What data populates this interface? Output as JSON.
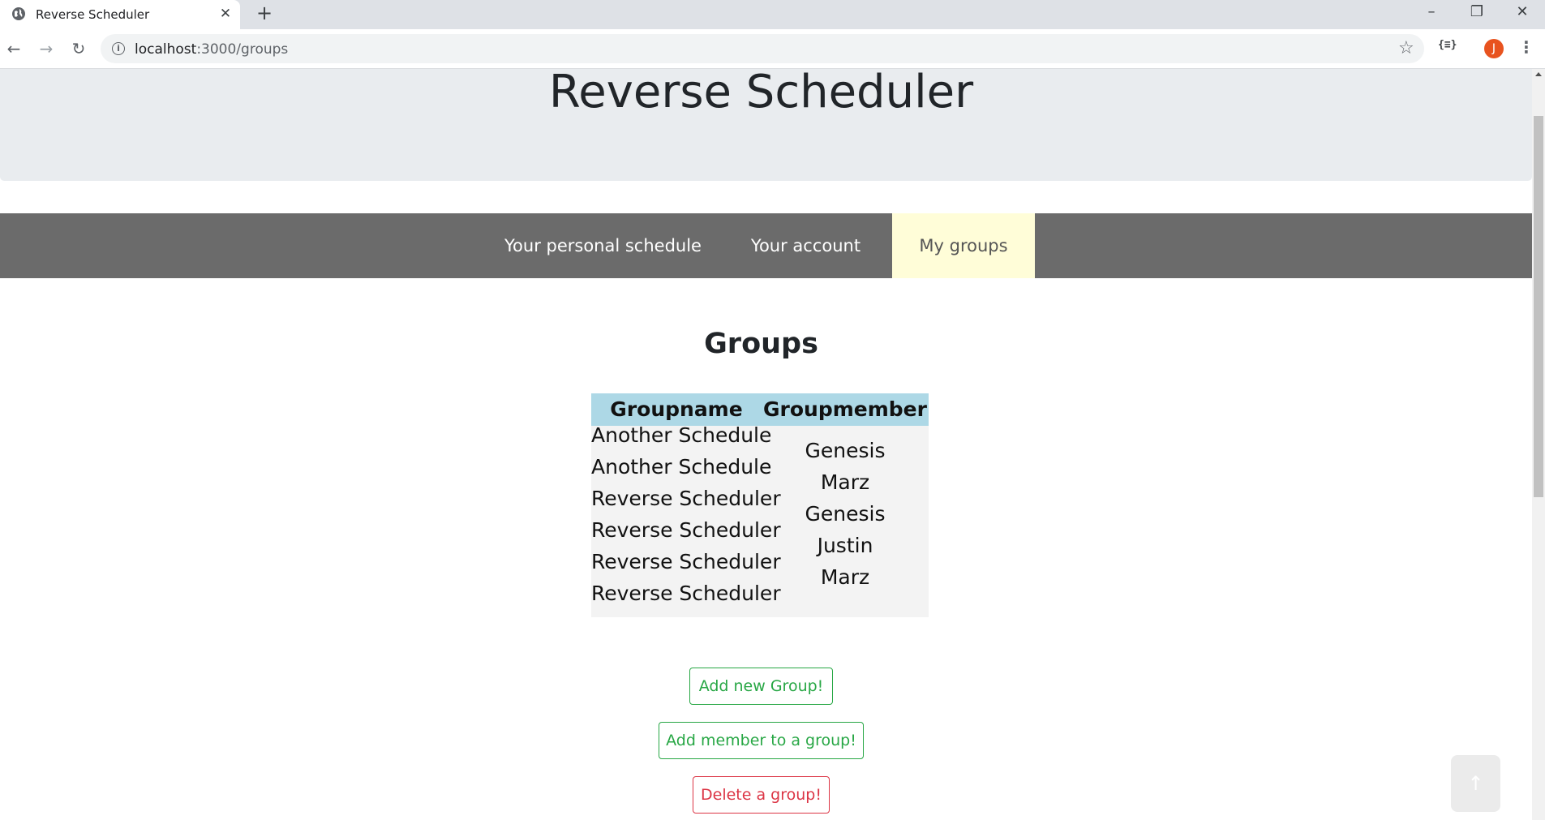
{
  "browser": {
    "tab_title": "Reverse Scheduler",
    "tab_close": "✕",
    "new_tab": "+",
    "url_host": "localhost",
    "url_path": ":3000/groups",
    "profile_initial": "J",
    "extension_label": "{≡}",
    "icons": [
      "globe-icon",
      "close-icon",
      "plus-icon",
      "back-icon",
      "forward-icon",
      "reload-icon",
      "info-icon",
      "star-icon",
      "extension-icon",
      "avatar",
      "menu-icon",
      "minimize-icon",
      "restore-icon",
      "close-window-icon"
    ]
  },
  "header": {
    "title": "Reverse Scheduler"
  },
  "nav": {
    "items": [
      {
        "label": "Your personal schedule",
        "active": false
      },
      {
        "label": "Your account",
        "active": false
      },
      {
        "label": "My groups",
        "active": true
      }
    ]
  },
  "main": {
    "heading": "Groups",
    "table": {
      "headers": [
        "Groupname",
        "Groupmember"
      ],
      "groupnames": [
        "Another Schedule",
        "Another Schedule",
        "Reverse Scheduler",
        "Reverse Scheduler",
        "Reverse Scheduler",
        "Reverse Scheduler"
      ],
      "groupmembers": [
        "Genesis",
        "Marz",
        "Genesis",
        "Justin",
        "Marz"
      ],
      "header_color": "#add8e6"
    },
    "buttons": {
      "add_group": "Add new Group!",
      "add_member": "Add member to a group!",
      "delete_group": "Delete a group!"
    },
    "back_to_top": "↑"
  },
  "colors": {
    "navbar": "#6b6b6b",
    "active_nav": "#fffdd8",
    "jumbotron": "#e9ecef",
    "success": "#28a745",
    "danger": "#dc3545"
  }
}
